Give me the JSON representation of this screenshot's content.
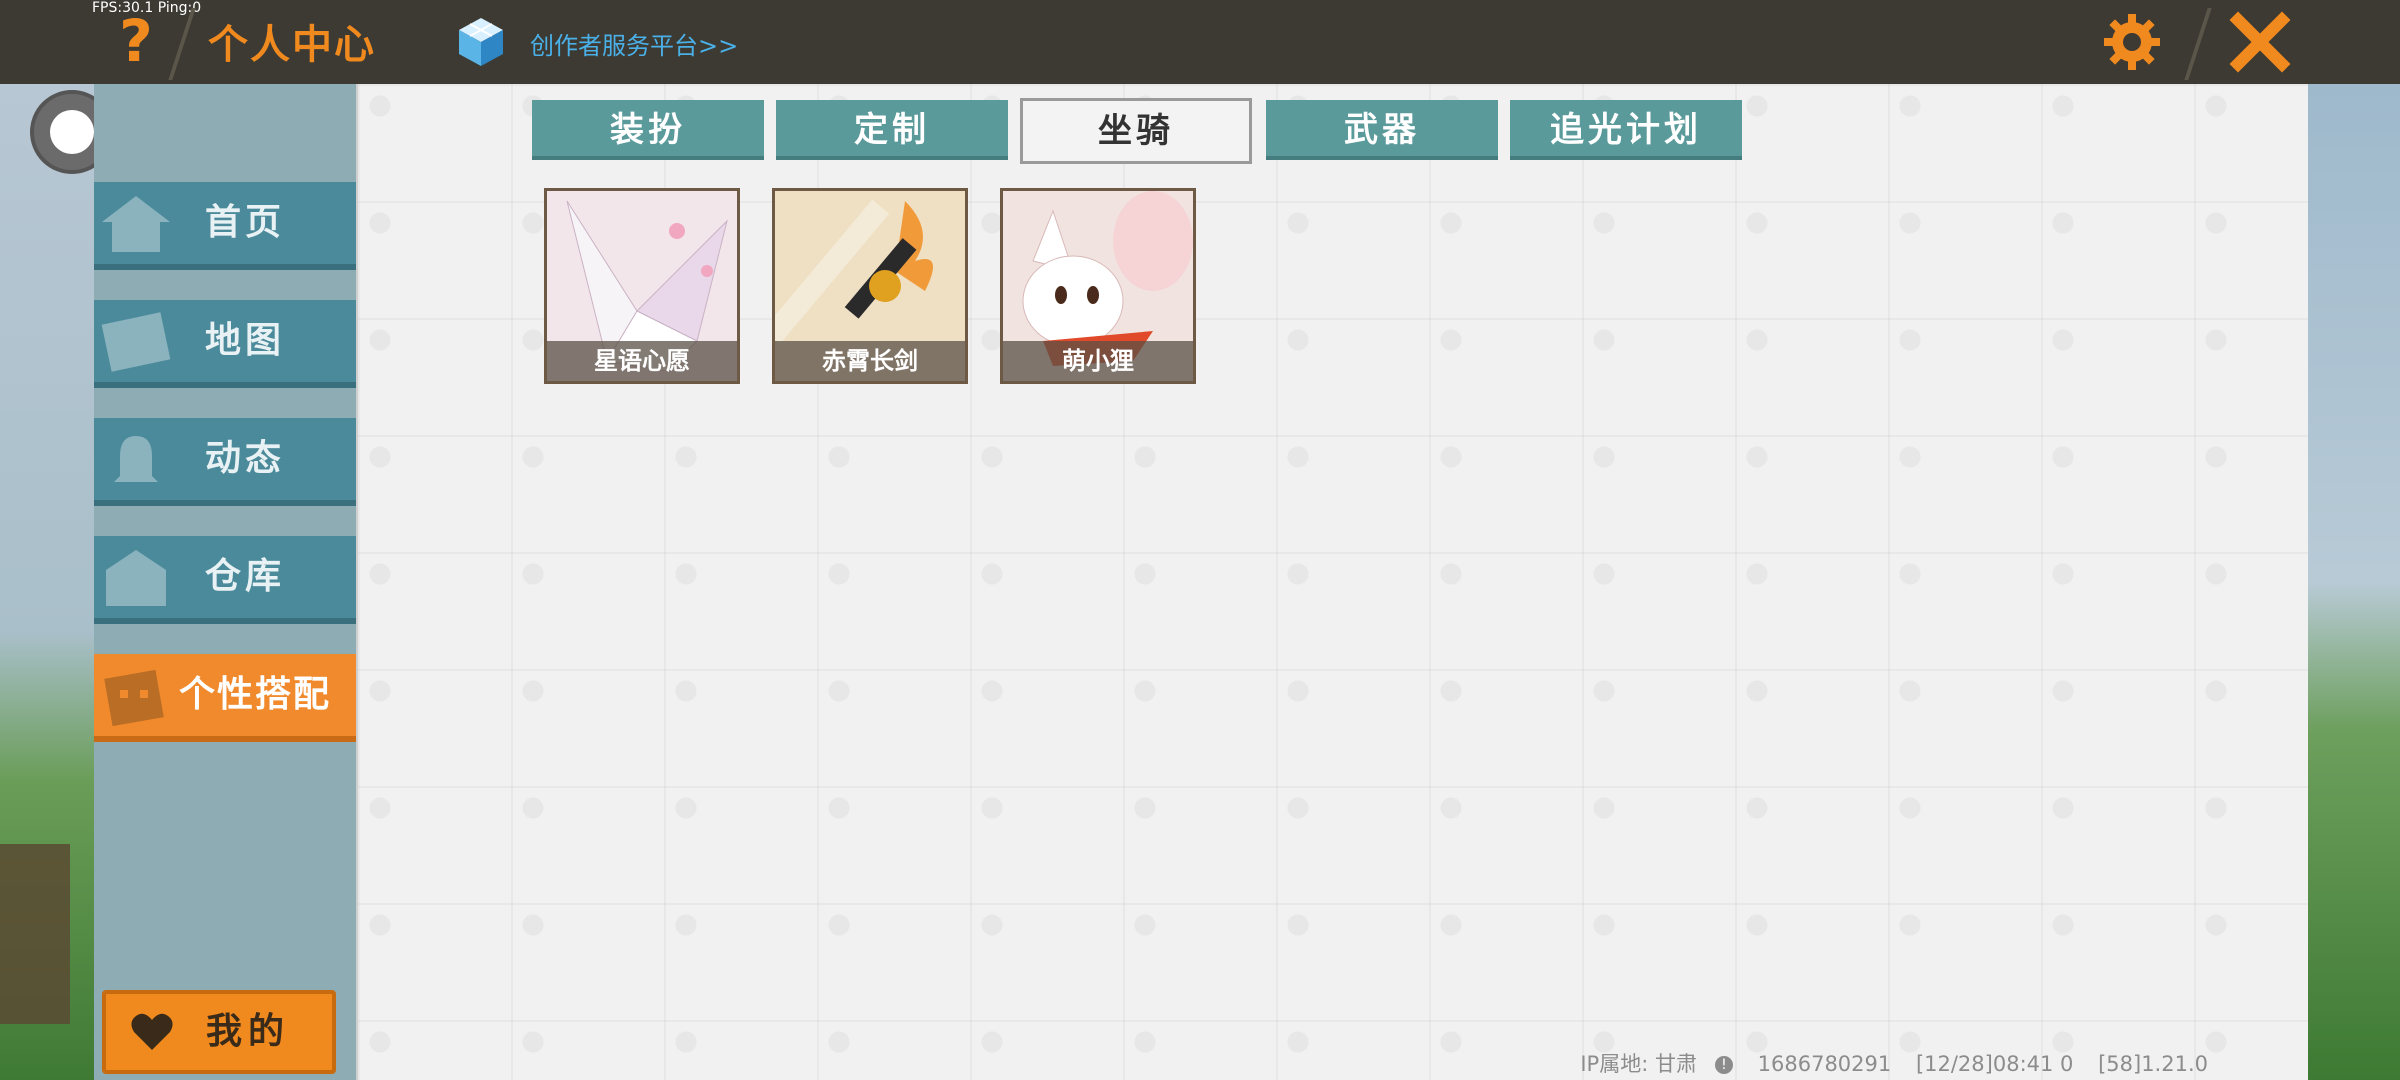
{
  "topbar": {
    "fps_text": "FPS:30.1  Ping:0",
    "help_glyph": "?",
    "title": "个人中心",
    "creator_link": "创作者服务平台>>",
    "accent_color": "#f08a1e"
  },
  "sidebar": {
    "items": [
      {
        "label": "首页",
        "icon": "home-icon"
      },
      {
        "label": "地图",
        "icon": "map-icon"
      },
      {
        "label": "动态",
        "icon": "bell-icon"
      },
      {
        "label": "仓库",
        "icon": "warehouse-icon"
      },
      {
        "label": "个性搭配",
        "icon": "character-icon",
        "active": true
      }
    ],
    "mine_button": "我的"
  },
  "tabs": [
    {
      "label": "装扮"
    },
    {
      "label": "定制"
    },
    {
      "label": "坐骑",
      "active": true
    },
    {
      "label": "武器"
    },
    {
      "label": "追光计划"
    }
  ],
  "items": [
    {
      "name": "星语心愿"
    },
    {
      "name": "赤霄长剑"
    },
    {
      "name": "萌小狸"
    }
  ],
  "footer": {
    "ip_label": "IP属地: 甘肃",
    "info_glyph": "!",
    "user_id": "1686780291",
    "timestamp": "[12/28]08:41 0",
    "version": "[58]1.21.0"
  }
}
